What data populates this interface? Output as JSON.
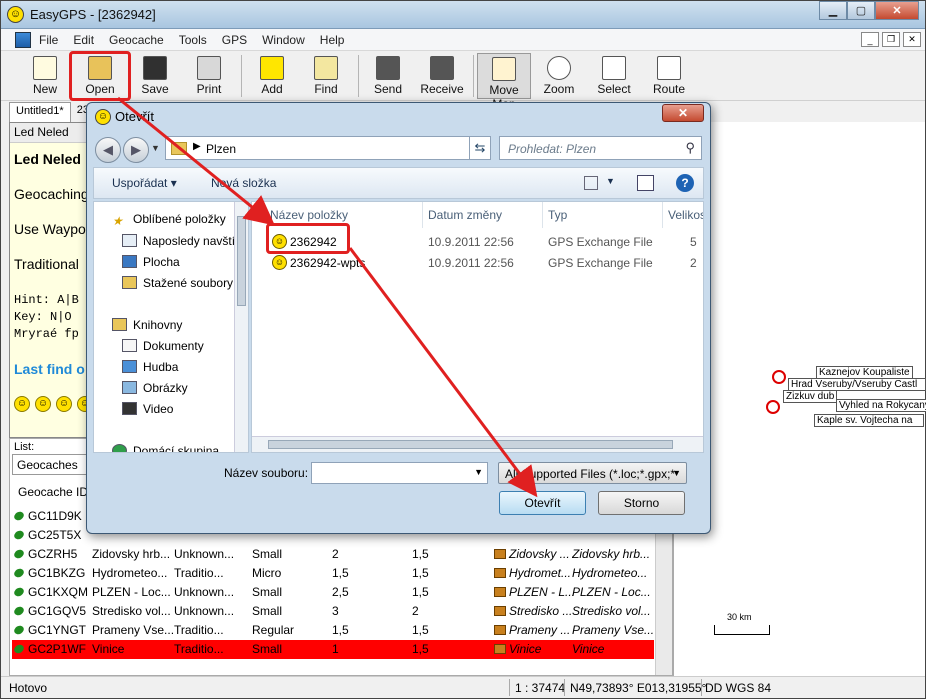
{
  "window": {
    "title": "EasyGPS - [2362942]"
  },
  "menu": [
    "File",
    "Edit",
    "Geocache",
    "Tools",
    "GPS",
    "Window",
    "Help"
  ],
  "toolbar": [
    {
      "label": "New",
      "icon": "new-icon"
    },
    {
      "label": "Open",
      "icon": "open-folder-icon"
    },
    {
      "label": "Save",
      "icon": "save-icon"
    },
    {
      "label": "Print",
      "icon": "print-icon"
    },
    {
      "label": "Add",
      "icon": "add-icon"
    },
    {
      "label": "Find",
      "icon": "find-binoculars-icon"
    },
    {
      "label": "Send",
      "icon": "send-gps-icon"
    },
    {
      "label": "Receive",
      "icon": "receive-gps-icon"
    },
    {
      "label": "Move Map",
      "icon": "hand-icon"
    },
    {
      "label": "Zoom",
      "icon": "zoom-icon"
    },
    {
      "label": "Select",
      "icon": "cursor-icon"
    },
    {
      "label": "Route",
      "icon": "route-icon"
    }
  ],
  "doc_tabs": [
    "Untitled1*",
    "23"
  ],
  "left_panel": {
    "header": "Led Neled",
    "title": "Led Neled",
    "lines": [
      "Geocaching",
      "Use Waypo",
      "Traditional"
    ],
    "hint_lines": [
      "Hint: A|B",
      "Key:  N|O",
      "Mryraé fp"
    ],
    "last_find": "Last find o"
  },
  "list": {
    "label": "List:",
    "combo": "Geocaches",
    "column": "Geocache ID",
    "rows": [
      {
        "id": "GC11D9K",
        "name": "",
        "type": "",
        "size": "",
        "d": "",
        "t": "",
        "n1": "",
        "n2": ""
      },
      {
        "id": "GC25T5X",
        "name": "",
        "type": "",
        "size": "",
        "d": "",
        "t": "",
        "n1": "",
        "n2": ""
      },
      {
        "id": "GCZRH5",
        "name": "Zidovsky hrb...",
        "type": "Unknown...",
        "size": "Small",
        "d": "2",
        "t": "1,5",
        "n1": "Zidovsky ...",
        "n2": "Zidovsky hrb..."
      },
      {
        "id": "GC1BKZG",
        "name": "Hydrometeo...",
        "type": "Traditio...",
        "size": "Micro",
        "d": "1,5",
        "t": "1,5",
        "n1": "Hydromet...",
        "n2": "Hydrometeo..."
      },
      {
        "id": "GC1KXQM",
        "name": "PLZEN - Loc...",
        "type": "Unknown...",
        "size": "Small",
        "d": "2,5",
        "t": "1,5",
        "n1": "PLZEN - L...",
        "n2": "PLZEN - Loc..."
      },
      {
        "id": "GC1GQV5",
        "name": "Stredisko vol...",
        "type": "Unknown...",
        "size": "Small",
        "d": "3",
        "t": "2",
        "n1": "Stredisko ...",
        "n2": "Stredisko vol..."
      },
      {
        "id": "GC1YNGT",
        "name": "Prameny Vse...",
        "type": "Traditio...",
        "size": "Regular",
        "d": "1,5",
        "t": "1,5",
        "n1": "Prameny ...",
        "n2": "Prameny Vse..."
      },
      {
        "id": "GC2P1WF",
        "name": "Vinice",
        "type": "Traditio...",
        "size": "Small",
        "d": "1",
        "t": "1,5",
        "n1": "Vinice",
        "n2": "Vinice",
        "selected": true
      }
    ]
  },
  "map": {
    "labels": [
      "Kaznejov Koupaliste",
      "Hrad Vseruby/Vseruby Castl",
      "Zizkuv dub",
      "Vyhled na Rokycany",
      "Kaple sv. Vojtecha na"
    ],
    "scale": "30 km"
  },
  "status": {
    "text": "Hotovo",
    "scale": "1 : 37474",
    "coords": "N49,73893° E013,31955°",
    "datum": "DD WGS 84"
  },
  "dialog": {
    "title": "Otevřít",
    "path": "Plzen",
    "search_placeholder": "Prohledat: Plzen",
    "organize": "Uspořádat",
    "new_folder": "Nová složka",
    "nav": {
      "favorites": "Oblíbené položky",
      "fav_items": [
        "Naposledy navští",
        "Plocha",
        "Stažené soubory"
      ],
      "libraries": "Knihovny",
      "lib_items": [
        "Dokumenty",
        "Hudba",
        "Obrázky",
        "Video"
      ],
      "homegroup": "Domácí skupina"
    },
    "columns": [
      "Název položky",
      "Datum změny",
      "Typ",
      "Velikos"
    ],
    "files": [
      {
        "name": "2362942",
        "date": "10.9.2011 22:56",
        "type": "GPS Exchange File",
        "size": "5"
      },
      {
        "name": "2362942-wpts",
        "date": "10.9.2011 22:56",
        "type": "GPS Exchange File",
        "size": "2"
      }
    ],
    "filename_label": "Název souboru:",
    "filter": "All Supported Files (*.loc;*.gpx;*",
    "open_button": "Otevřít",
    "cancel_button": "Storno"
  },
  "colors": {
    "highlight": "#e02020",
    "selected_row": "#ff0000"
  }
}
